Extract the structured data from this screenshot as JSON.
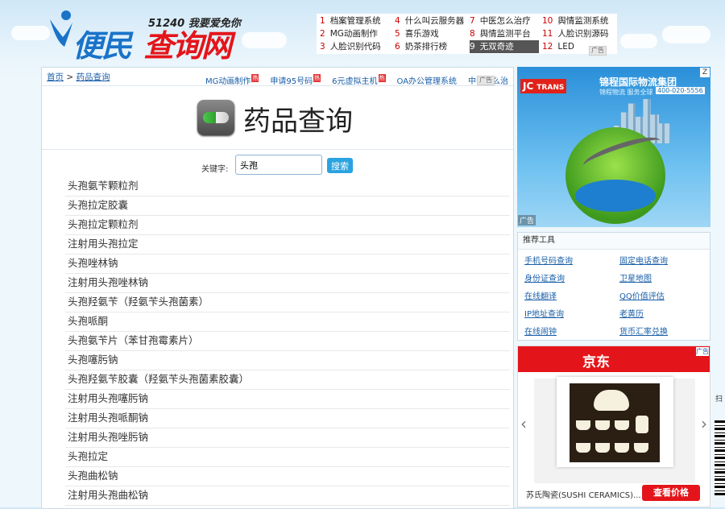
{
  "header": {
    "tagline": "51240 我要爱免你",
    "brand_part1": "便民",
    "brand_part2": "查询网",
    "top_links": [
      {
        "num": "1",
        "label": "档案管理系统"
      },
      {
        "num": "2",
        "label": "MG动画制作"
      },
      {
        "num": "3",
        "label": "人脸识别代码"
      },
      {
        "num": "4",
        "label": "什么叫云服务器"
      },
      {
        "num": "5",
        "label": "喜乐游戏"
      },
      {
        "num": "6",
        "label": "奶茶排行榜"
      },
      {
        "num": "7",
        "label": "中医怎么治疗"
      },
      {
        "num": "8",
        "label": "舆情监测平台"
      },
      {
        "num": "9",
        "label": "无双奇迹"
      },
      {
        "num": "10",
        "label": "舆情监测系统"
      },
      {
        "num": "11",
        "label": "人脸识别源码"
      },
      {
        "num": "12",
        "label": "LED"
      }
    ],
    "ad_badge": "广告"
  },
  "main": {
    "breadcrumb": {
      "home": "首页",
      "sep": ">",
      "current": "药品查询"
    },
    "quick_links": [
      {
        "label": "MG动画制作",
        "hot": "热"
      },
      {
        "label": "申请95号码",
        "hot": "热"
      },
      {
        "label": "6元虚拟主机",
        "hot": "热"
      },
      {
        "label": "OA办公管理系统",
        "hot": ""
      },
      {
        "label": "中医怎么治",
        "hot": ""
      }
    ],
    "ad_badge": "广告",
    "page_title": "药品查询",
    "search": {
      "label": "关键字:",
      "value": "头孢",
      "button": "搜索"
    },
    "results": [
      "头孢氨苄颗粒剂",
      "头孢拉定胶囊",
      "头孢拉定颗粒剂",
      "注射用头孢拉定",
      "头孢唑林钠",
      "注射用头孢唑林钠",
      "头孢羟氨苄（羟氨苄头孢菌素）",
      "头孢哌酮",
      "头孢氨苄片（苯甘孢霉素片）",
      "头孢噻肟钠",
      "头孢羟氨苄胶囊（羟氨苄头孢菌素胶囊）",
      "注射用头孢噻肟钠",
      "注射用头孢哌酮钠",
      "注射用头孢唑肟钠",
      "头孢拉定",
      "头孢曲松钠",
      "注射用头孢曲松钠"
    ]
  },
  "sidebar": {
    "ad1": {
      "brand": "JC",
      "brand_sub": "TRANS",
      "company": "锦程国际物流集团",
      "slogan": "锦程物流 服务全球",
      "phone": "400-020-5556",
      "ad_label": "广告",
      "corner": "Z"
    },
    "tools": {
      "title": "推荐工具",
      "items": [
        "手机号码查询",
        "固定电话查询",
        "身份证查询",
        "卫星地图",
        "在线翻译",
        "QQ价值评估",
        "IP地址查询",
        "老黄历",
        "在线闹钟",
        "货币汇率兑换"
      ]
    },
    "ad2": {
      "logo": "京东",
      "caption": "苏氏陶瓷(SUSHI CERAMICS)...",
      "button": "查看价格",
      "ad_corner": "广告"
    }
  },
  "edge": {
    "side_text": "扫"
  }
}
